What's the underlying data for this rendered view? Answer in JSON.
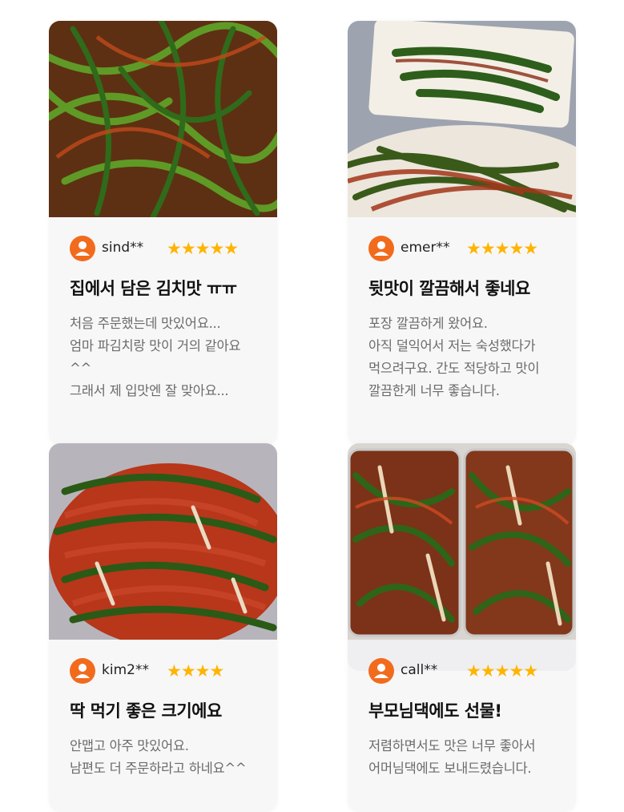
{
  "colors": {
    "accent": "#f26b1d",
    "star": "#ffb400",
    "card_bg": "#f7f7f8"
  },
  "reviews": [
    {
      "user": "sind**",
      "stars": "★★★★★",
      "title": "집에서 담은 김치맛 ㅠㅠ",
      "lines": [
        "처음 주문했는데 맛있어요...",
        "엄마 파김치랑 맛이 거의 같아요",
        "^^",
        "그래서 제 입맛엔 잘 맞아요..."
      ]
    },
    {
      "user": "emer**",
      "stars": "★★★★★",
      "title": "뒷맛이 깔끔해서 좋네요",
      "lines": [
        "포장 깔끔하게 왔어요.",
        "아직 덜익어서 저는 숙성했다가",
        "먹으려구요. 간도 적당하고 맛이",
        "깔끔한게 너무 좋습니다."
      ]
    },
    {
      "user": "kim2**",
      "stars": "★★★★",
      "title": "딱 먹기 좋은 크기에요",
      "lines": [
        "안맵고 아주 맛있어요.",
        "남편도 더 주문하라고 하네요^^"
      ]
    },
    {
      "user": "call**",
      "stars": "★★★★★",
      "title": "부모님댁에도 선물!",
      "lines": [
        "저렴하면서도 맛은 너무 좋아서",
        "어머님댁에도 보내드렸습니다."
      ]
    }
  ]
}
